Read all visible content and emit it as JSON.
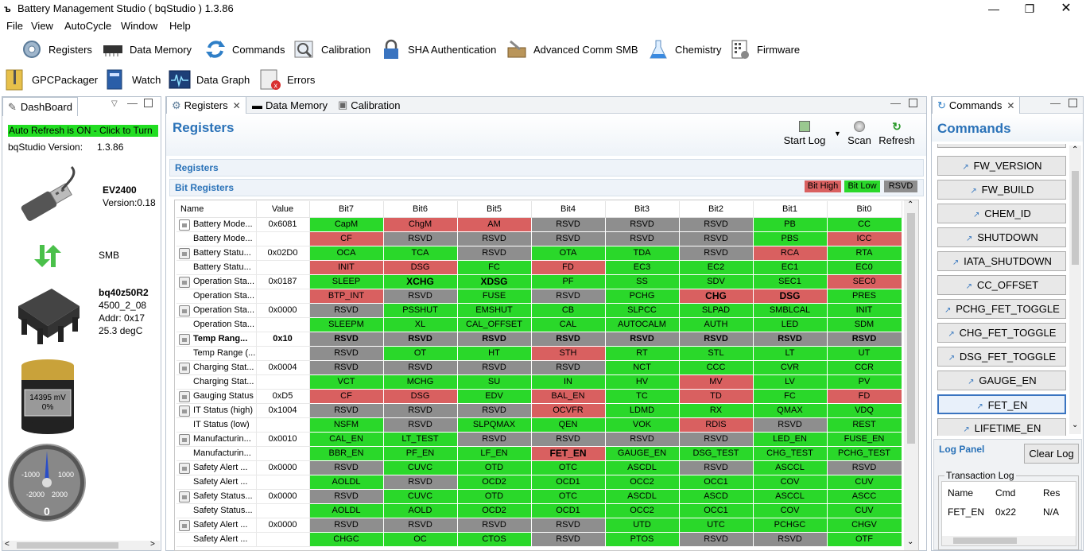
{
  "window": {
    "title": "Battery Management Studio ( bqStudio ) 1.3.86"
  },
  "menu": [
    "File",
    "View",
    "AutoCycle",
    "Window",
    "Help"
  ],
  "toolbar": [
    {
      "label": "Registers",
      "icon": "gear-icon"
    },
    {
      "label": "Data Memory",
      "icon": "chip-icon"
    },
    {
      "label": "Commands",
      "icon": "refresh-arrows-icon"
    },
    {
      "label": "Calibration",
      "icon": "magnifier-icon"
    },
    {
      "label": "SHA Authentication",
      "icon": "lock-icon"
    },
    {
      "label": "Advanced Comm SMB",
      "icon": "toolbox-icon"
    },
    {
      "label": "Chemistry",
      "icon": "flask-icon"
    },
    {
      "label": "Firmware",
      "icon": "firmware-chip-icon"
    },
    {
      "label": "GPCPackager",
      "icon": "zip-icon"
    },
    {
      "label": "Watch",
      "icon": "book-icon"
    },
    {
      "label": "Data Graph",
      "icon": "graph-icon"
    },
    {
      "label": "Errors",
      "icon": "error-icon"
    }
  ],
  "dashboard": {
    "tab": "DashBoard",
    "refresh": "Auto Refresh is ON - Click to Turn",
    "version_label": "bqStudio Version:",
    "version": "1.3.86",
    "ev_name": "EV2400",
    "ev_version": "Version:0.18",
    "bus": "SMB",
    "device": "bq40z50R2",
    "fw": "4500_2_08",
    "addr": "Addr: 0x17",
    "temp": "25.3 degC",
    "voltage": "14395 mV",
    "soc": "0%",
    "gauge": {
      "ticks": [
        "-1000",
        "1000",
        "-2000",
        "2000"
      ],
      "value": "0"
    }
  },
  "tabs": [
    "Registers",
    "Data Memory",
    "Calibration"
  ],
  "registers": {
    "title": "Registers",
    "actions": {
      "startlog": "Start Log",
      "scan": "Scan",
      "refresh": "Refresh"
    },
    "section": "Registers",
    "bitsection": "Bit Registers",
    "legend": {
      "high": "Bit High",
      "low": "Bit Low",
      "rsvd": "RSVD"
    },
    "legend_colors": {
      "high": "#d96060",
      "low": "#2ad82a",
      "rsvd": "#8e8e8e"
    },
    "columns": [
      "Name",
      "Value",
      "Bit7",
      "Bit6",
      "Bit5",
      "Bit4",
      "Bit3",
      "Bit2",
      "Bit1",
      "Bit0"
    ],
    "rows": [
      {
        "n": "Battery Mode...",
        "v": "0x6081",
        "icon": "edit",
        "b": [
          [
            "CapM",
            "G"
          ],
          [
            "ChgM",
            "R"
          ],
          [
            "AM",
            "R"
          ],
          [
            "RSVD",
            "N"
          ],
          [
            "RSVD",
            "N"
          ],
          [
            "RSVD",
            "N"
          ],
          [
            "PB",
            "G"
          ],
          [
            "CC",
            "G"
          ]
        ]
      },
      {
        "n": "Battery Mode...",
        "v": "",
        "icon": "",
        "b": [
          [
            "CF",
            "R"
          ],
          [
            "RSVD",
            "N"
          ],
          [
            "RSVD",
            "N"
          ],
          [
            "RSVD",
            "N"
          ],
          [
            "RSVD",
            "N"
          ],
          [
            "RSVD",
            "N"
          ],
          [
            "PBS",
            "G"
          ],
          [
            "ICC",
            "R"
          ]
        ]
      },
      {
        "n": "Battery Statu...",
        "v": "0x02D0",
        "icon": "lock",
        "b": [
          [
            "OCA",
            "G"
          ],
          [
            "TCA",
            "G"
          ],
          [
            "RSVD",
            "N"
          ],
          [
            "OTA",
            "G"
          ],
          [
            "TDA",
            "G"
          ],
          [
            "RSVD",
            "N"
          ],
          [
            "RCA",
            "R"
          ],
          [
            "RTA",
            "G"
          ]
        ]
      },
      {
        "n": "Battery Statu...",
        "v": "",
        "icon": "",
        "b": [
          [
            "INIT",
            "R"
          ],
          [
            "DSG",
            "R"
          ],
          [
            "FC",
            "G"
          ],
          [
            "FD",
            "R"
          ],
          [
            "EC3",
            "G"
          ],
          [
            "EC2",
            "G"
          ],
          [
            "EC1",
            "G"
          ],
          [
            "EC0",
            "G"
          ]
        ]
      },
      {
        "n": "Operation Sta...",
        "v": "0x0187",
        "icon": "lock",
        "b": [
          [
            "SLEEP",
            "G"
          ],
          [
            "XCHG",
            "G",
            "b"
          ],
          [
            "XDSG",
            "G",
            "b"
          ],
          [
            "PF",
            "G"
          ],
          [
            "SS",
            "G"
          ],
          [
            "SDV",
            "G"
          ],
          [
            "SEC1",
            "G"
          ],
          [
            "SEC0",
            "R"
          ]
        ]
      },
      {
        "n": "Operation Sta...",
        "v": "",
        "icon": "",
        "b": [
          [
            "BTP_INT",
            "R"
          ],
          [
            "RSVD",
            "N"
          ],
          [
            "FUSE",
            "G"
          ],
          [
            "RSVD",
            "N"
          ],
          [
            "PCHG",
            "G"
          ],
          [
            "CHG",
            "R",
            "b"
          ],
          [
            "DSG",
            "R",
            "b"
          ],
          [
            "PRES",
            "G"
          ]
        ]
      },
      {
        "n": "Operation Sta...",
        "v": "0x0000",
        "icon": "lock",
        "b": [
          [
            "RSVD",
            "N"
          ],
          [
            "PSSHUT",
            "G"
          ],
          [
            "EMSHUT",
            "G"
          ],
          [
            "CB",
            "G"
          ],
          [
            "SLPCC",
            "G"
          ],
          [
            "SLPAD",
            "G"
          ],
          [
            "SMBLCAL",
            "G"
          ],
          [
            "INIT",
            "G"
          ]
        ]
      },
      {
        "n": "Operation Sta...",
        "v": "",
        "icon": "",
        "b": [
          [
            "SLEEPM",
            "G"
          ],
          [
            "XL",
            "G"
          ],
          [
            "CAL_OFFSET",
            "G"
          ],
          [
            "CAL",
            "G"
          ],
          [
            "AUTOCALM",
            "G"
          ],
          [
            "AUTH",
            "G"
          ],
          [
            "LED",
            "G"
          ],
          [
            "SDM",
            "G"
          ]
        ]
      },
      {
        "n": "Temp Rang...",
        "v": "0x10",
        "icon": "lock",
        "bold": true,
        "b": [
          [
            "RSVD",
            "N"
          ],
          [
            "RSVD",
            "N"
          ],
          [
            "RSVD",
            "N"
          ],
          [
            "RSVD",
            "N"
          ],
          [
            "RSVD",
            "N"
          ],
          [
            "RSVD",
            "N"
          ],
          [
            "RSVD",
            "N"
          ],
          [
            "RSVD",
            "N"
          ]
        ]
      },
      {
        "n": "Temp Range (...",
        "v": "",
        "icon": "",
        "b": [
          [
            "RSVD",
            "N"
          ],
          [
            "OT",
            "G"
          ],
          [
            "HT",
            "G"
          ],
          [
            "STH",
            "R"
          ],
          [
            "RT",
            "G"
          ],
          [
            "STL",
            "G"
          ],
          [
            "LT",
            "G"
          ],
          [
            "UT",
            "G"
          ]
        ]
      },
      {
        "n": "Charging Stat...",
        "v": "0x0004",
        "icon": "lock",
        "b": [
          [
            "RSVD",
            "N"
          ],
          [
            "RSVD",
            "N"
          ],
          [
            "RSVD",
            "N"
          ],
          [
            "RSVD",
            "N"
          ],
          [
            "NCT",
            "G"
          ],
          [
            "CCC",
            "G"
          ],
          [
            "CVR",
            "G"
          ],
          [
            "CCR",
            "G"
          ]
        ]
      },
      {
        "n": "Charging Stat...",
        "v": "",
        "icon": "",
        "b": [
          [
            "VCT",
            "G"
          ],
          [
            "MCHG",
            "G"
          ],
          [
            "SU",
            "G"
          ],
          [
            "IN",
            "G"
          ],
          [
            "HV",
            "G"
          ],
          [
            "MV",
            "R"
          ],
          [
            "LV",
            "G"
          ],
          [
            "PV",
            "G"
          ]
        ]
      },
      {
        "n": "Gauging Status",
        "v": "0xD5",
        "icon": "lock",
        "b": [
          [
            "CF",
            "R"
          ],
          [
            "DSG",
            "R"
          ],
          [
            "EDV",
            "G"
          ],
          [
            "BAL_EN",
            "R"
          ],
          [
            "TC",
            "G"
          ],
          [
            "TD",
            "R"
          ],
          [
            "FC",
            "G"
          ],
          [
            "FD",
            "R"
          ]
        ]
      },
      {
        "n": "IT Status (high)",
        "v": "0x1004",
        "icon": "lock",
        "b": [
          [
            "RSVD",
            "N"
          ],
          [
            "RSVD",
            "N"
          ],
          [
            "RSVD",
            "N"
          ],
          [
            "OCVFR",
            "R"
          ],
          [
            "LDMD",
            "G"
          ],
          [
            "RX",
            "G"
          ],
          [
            "QMAX",
            "G"
          ],
          [
            "VDQ",
            "G"
          ]
        ]
      },
      {
        "n": "IT Status (low)",
        "v": "",
        "icon": "",
        "b": [
          [
            "NSFM",
            "G"
          ],
          [
            "RSVD",
            "N"
          ],
          [
            "SLPQMAX",
            "G"
          ],
          [
            "QEN",
            "G"
          ],
          [
            "VOK",
            "G"
          ],
          [
            "RDIS",
            "R"
          ],
          [
            "RSVD",
            "N"
          ],
          [
            "REST",
            "G"
          ]
        ]
      },
      {
        "n": "Manufacturin...",
        "v": "0x0010",
        "icon": "lock",
        "b": [
          [
            "CAL_EN",
            "G"
          ],
          [
            "LT_TEST",
            "G"
          ],
          [
            "RSVD",
            "N"
          ],
          [
            "RSVD",
            "N"
          ],
          [
            "RSVD",
            "N"
          ],
          [
            "RSVD",
            "N"
          ],
          [
            "LED_EN",
            "G"
          ],
          [
            "FUSE_EN",
            "G"
          ]
        ]
      },
      {
        "n": "Manufacturin...",
        "v": "",
        "icon": "",
        "b": [
          [
            "BBR_EN",
            "G"
          ],
          [
            "PF_EN",
            "G"
          ],
          [
            "LF_EN",
            "G"
          ],
          [
            "FET_EN",
            "R",
            "b"
          ],
          [
            "GAUGE_EN",
            "G"
          ],
          [
            "DSG_TEST",
            "G"
          ],
          [
            "CHG_TEST",
            "G"
          ],
          [
            "PCHG_TEST",
            "G"
          ]
        ]
      },
      {
        "n": "Safety Alert ...",
        "v": "0x0000",
        "icon": "lock",
        "b": [
          [
            "RSVD",
            "N"
          ],
          [
            "CUVC",
            "G"
          ],
          [
            "OTD",
            "G"
          ],
          [
            "OTC",
            "G"
          ],
          [
            "ASCDL",
            "G"
          ],
          [
            "RSVD",
            "N"
          ],
          [
            "ASCCL",
            "G"
          ],
          [
            "RSVD",
            "N"
          ]
        ]
      },
      {
        "n": "Safety Alert ...",
        "v": "",
        "icon": "",
        "b": [
          [
            "AOLDL",
            "G"
          ],
          [
            "RSVD",
            "N"
          ],
          [
            "OCD2",
            "G"
          ],
          [
            "OCD1",
            "G"
          ],
          [
            "OCC2",
            "G"
          ],
          [
            "OCC1",
            "G"
          ],
          [
            "COV",
            "G"
          ],
          [
            "CUV",
            "G"
          ]
        ]
      },
      {
        "n": "Safety Status...",
        "v": "0x0000",
        "icon": "lock",
        "b": [
          [
            "RSVD",
            "N"
          ],
          [
            "CUVC",
            "G"
          ],
          [
            "OTD",
            "G"
          ],
          [
            "OTC",
            "G"
          ],
          [
            "ASCDL",
            "G"
          ],
          [
            "ASCD",
            "G"
          ],
          [
            "ASCCL",
            "G"
          ],
          [
            "ASCC",
            "G"
          ]
        ]
      },
      {
        "n": "Safety Status...",
        "v": "",
        "icon": "",
        "b": [
          [
            "AOLDL",
            "G"
          ],
          [
            "AOLD",
            "G"
          ],
          [
            "OCD2",
            "G"
          ],
          [
            "OCD1",
            "G"
          ],
          [
            "OCC2",
            "G"
          ],
          [
            "OCC1",
            "G"
          ],
          [
            "COV",
            "G"
          ],
          [
            "CUV",
            "G"
          ]
        ]
      },
      {
        "n": "Safety Alert ...",
        "v": "0x0000",
        "icon": "lock",
        "b": [
          [
            "RSVD",
            "N"
          ],
          [
            "RSVD",
            "N"
          ],
          [
            "RSVD",
            "N"
          ],
          [
            "RSVD",
            "N"
          ],
          [
            "UTD",
            "G"
          ],
          [
            "UTC",
            "G"
          ],
          [
            "PCHGC",
            "G"
          ],
          [
            "CHGV",
            "G"
          ]
        ]
      },
      {
        "n": "Safety Alert ...",
        "v": "",
        "icon": "",
        "b": [
          [
            "CHGC",
            "G"
          ],
          [
            "OC",
            "G"
          ],
          [
            "CTOS",
            "G"
          ],
          [
            "RSVD",
            "N"
          ],
          [
            "PTOS",
            "G"
          ],
          [
            "RSVD",
            "N"
          ],
          [
            "RSVD",
            "N"
          ],
          [
            "OTF",
            "G"
          ]
        ]
      }
    ]
  },
  "commands": {
    "tab": "Commands",
    "title": "Commands",
    "buttons": [
      "FW_VERSION",
      "FW_BUILD",
      "CHEM_ID",
      "SHUTDOWN",
      "IATA_SHUTDOWN",
      "CC_OFFSET",
      "PCHG_FET_TOGGLE",
      "CHG_FET_TOGGLE",
      "DSG_FET_TOGGLE",
      "GAUGE_EN",
      "FET_EN",
      "LIFETIME_EN"
    ],
    "selected": "FET_EN"
  },
  "log": {
    "title": "Log Panel",
    "clear": "Clear Log",
    "group": "Transaction Log",
    "columns": [
      "Name",
      "Cmd",
      "Res"
    ],
    "row": [
      "FET_EN",
      "0x22",
      "N/A"
    ]
  }
}
